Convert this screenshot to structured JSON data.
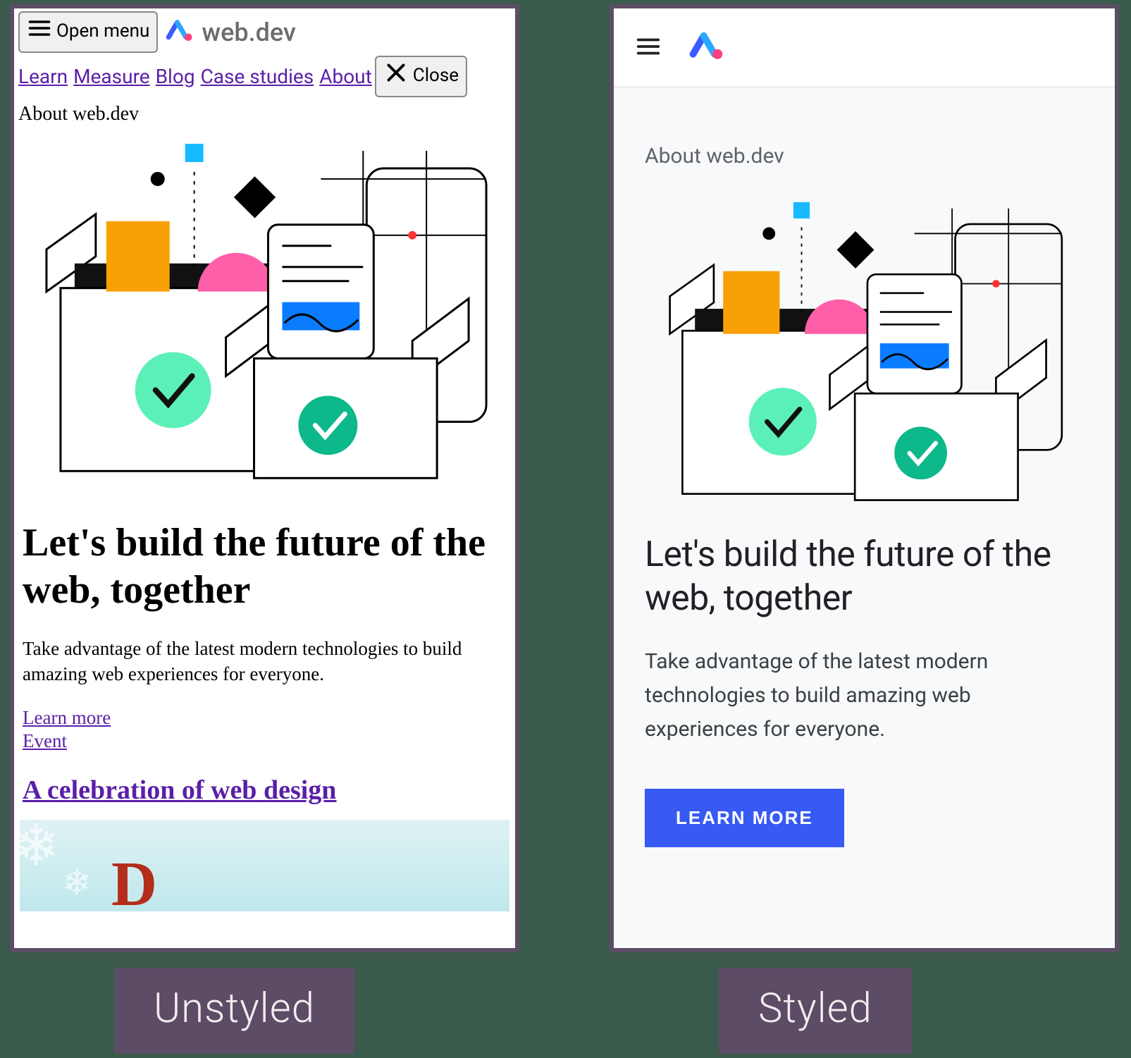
{
  "captions": {
    "left": "Unstyled",
    "right": "Styled"
  },
  "brand": {
    "text": "web.dev"
  },
  "unstyled": {
    "open_menu": "Open menu",
    "close": "Close",
    "nav": {
      "learn": "Learn",
      "measure": "Measure",
      "blog": "Blog",
      "case_studies": "Case studies",
      "about": "About"
    },
    "kicker": "About web.dev",
    "headline": "Let's build the future of the web, together",
    "body": "Take advantage of the latest modern technologies to build amazing web experiences for everyone.",
    "learn_more": "Learn more",
    "event": "Event",
    "h2": "A celebration of web design"
  },
  "styled": {
    "kicker": "About web.dev",
    "headline": "Let's build the future of the web, together",
    "body": "Take advantage of the latest modern technologies to build amazing web experiences for everyone.",
    "cta": "LEARN MORE"
  }
}
